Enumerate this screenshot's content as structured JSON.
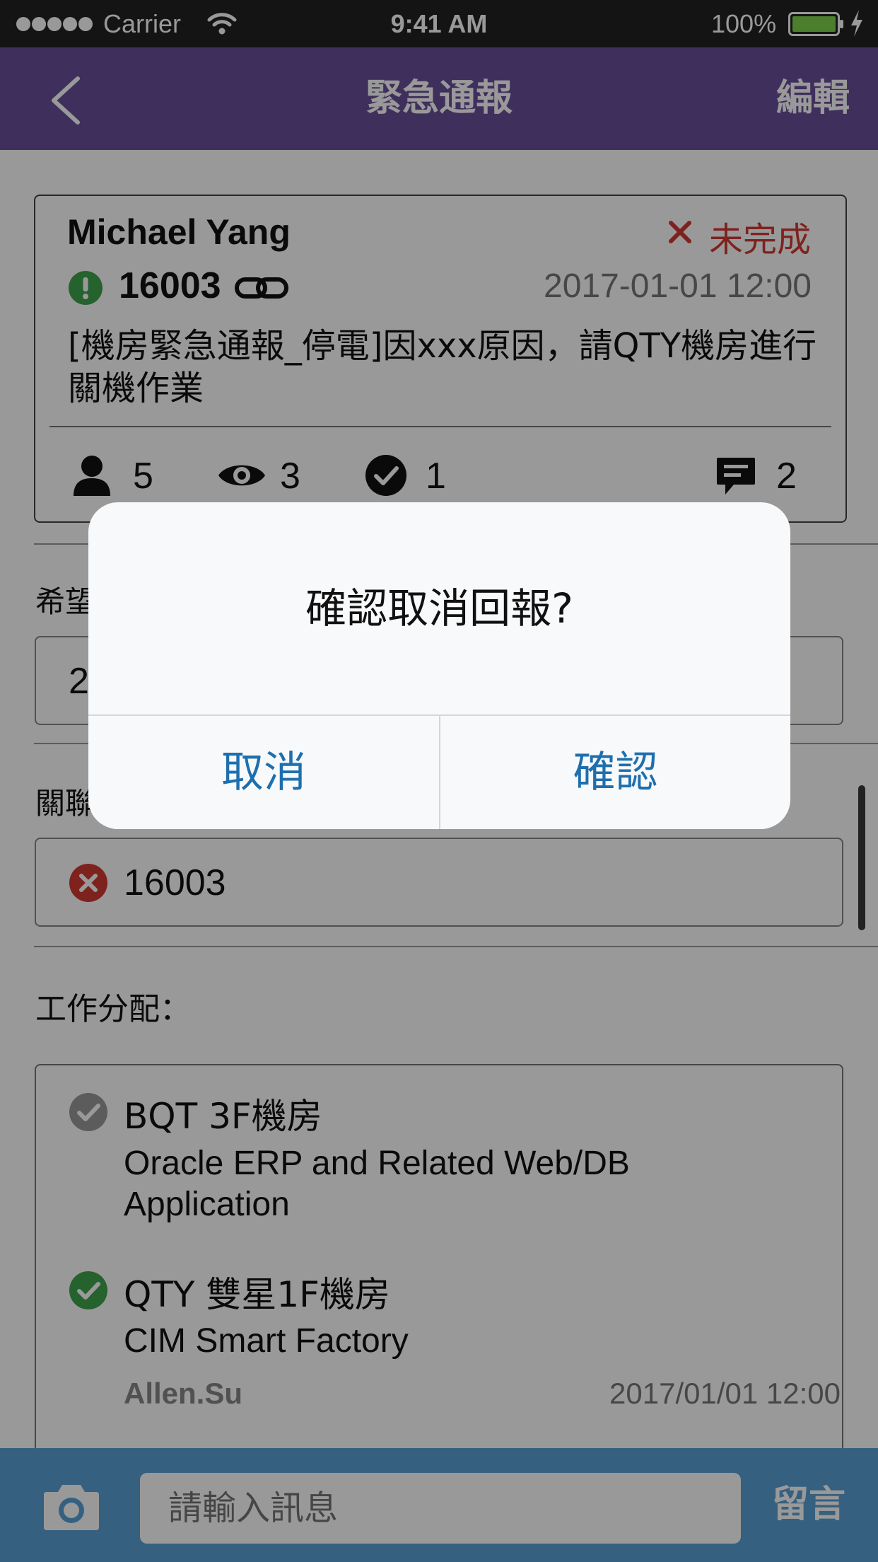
{
  "status_bar": {
    "carrier": "Carrier",
    "time": "9:41 AM",
    "battery": "100%"
  },
  "nav": {
    "title": "緊急通報",
    "edit_label": "編輯"
  },
  "report": {
    "author": "Michael Yang",
    "status": "未完成",
    "ticket_id": "16003",
    "datetime": "2017-01-01 12:00",
    "message": "[機房緊急通報_停電]因xxx原因，請QTY機房進行關機作業",
    "stats": {
      "people": "5",
      "views": "3",
      "confirmed": "1",
      "comments": "2"
    }
  },
  "form": {
    "expected_label_partial": "希望",
    "expected_value_partial": "2",
    "related_label_partial": "關聯",
    "related_item": "16003",
    "work_label": "工作分配："
  },
  "assignments": [
    {
      "location": "BQT 3F機房",
      "system": "Oracle ERP and Related Web/DB Application",
      "status": "done-gray"
    },
    {
      "location": "QTY 雙星1F機房",
      "system": "CIM Smart Factory",
      "user": "Allen.Su",
      "datetime": "2017/01/01 12:00",
      "status": "done-green"
    }
  ],
  "bottom": {
    "input_placeholder": "請輸入訊息",
    "send_label": "留言"
  },
  "dialog": {
    "message": "確認取消回報?",
    "cancel_label": "取消",
    "confirm_label": "確認"
  },
  "colors": {
    "nav_bg": "#6a4f9c",
    "status_red": "#d23a32",
    "ok_green": "#3fa34d",
    "dialog_button": "#1e6fae",
    "bottom_bar": "#5aa0d6"
  },
  "icons": [
    "back-chevron-icon",
    "cross-icon",
    "exclamation-icon",
    "link-icon",
    "person-icon",
    "eye-icon",
    "check-circle-icon",
    "comment-icon",
    "error-circle-icon",
    "camera-icon",
    "wifi-icon",
    "battery-icon",
    "charging-icon"
  ]
}
